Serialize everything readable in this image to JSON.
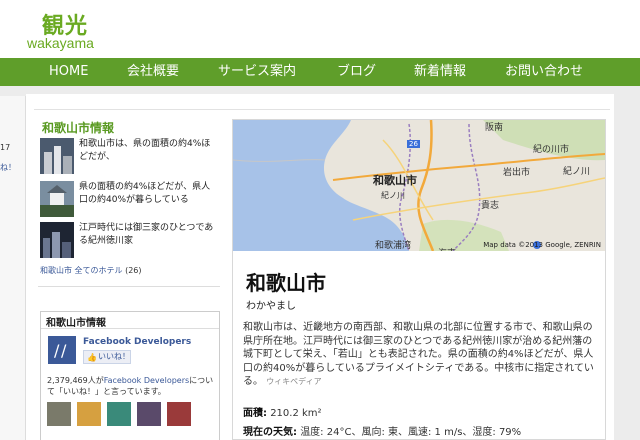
{
  "site": {
    "title": "観光",
    "subtitle": "wakayama"
  },
  "nav": {
    "items": [
      "HOME",
      "会社概要",
      "サービス案内",
      "ブログ",
      "新着情報",
      "お問い合わせ"
    ]
  },
  "left_edge": {
    "line1": "17",
    "line2": "ね！"
  },
  "sidebar": {
    "title": "和歌山市情報",
    "items": [
      {
        "text": "和歌山市は、県の面積の約4%ほどだが、"
      },
      {
        "text": "県の面積の約4%ほどだが、県人口の約40%が暮らしている"
      },
      {
        "text": "江戸時代には御三家のひとつである紀州徳川家"
      }
    ],
    "link_text": "和歌山市 全てのホテル",
    "link_count": "(26)"
  },
  "facebook": {
    "box_title": "和歌山市情報",
    "page_name": "Facebook Developers",
    "like_label": "いいね！",
    "like_count_prefix": "2,379,469人が",
    "like_count_link": "Facebook Developers",
    "like_count_suffix": "について「いいね！」と言っています。"
  },
  "map": {
    "labels": {
      "wakayama_city": "和歌山市",
      "kinokawa_city": "紀の川市",
      "iwade_city": "岩出市",
      "kinokawa": "紀ノ川",
      "kishi": "貴志",
      "kinokawa_river": "紀ノ川",
      "wakaura": "和歌浦湾",
      "kainan": "海南",
      "hannan": "阪南",
      "route_26": "26"
    },
    "credit": "Map data ©2013 Google, ZENRIN"
  },
  "knowledge": {
    "title": "和歌山市",
    "reading": "わかやまし",
    "description": "和歌山市は、近畿地方の南西部、和歌山県の北部に位置する市で、和歌山県の県庁所在地。江戸時代には御三家のひとつである紀州徳川家が治める紀州藩の城下町として栄え、「若山」とも表記された。県の面積の約4%ほどだが、県人口の約40%が暮らしているプライメイトシティである。中核市に指定されている。",
    "source": "ウィキペディア",
    "area_label": "面積:",
    "area_value": "210.2 km²",
    "weather_label": "現在の天気:",
    "weather_value": "温度: 24°C、風向: 東、風速: 1 m/s、湿度: 79%"
  },
  "colors": {
    "brand_green": "#6aaa22",
    "nav_green": "#5f9e2a",
    "link_blue": "#3b5998"
  }
}
